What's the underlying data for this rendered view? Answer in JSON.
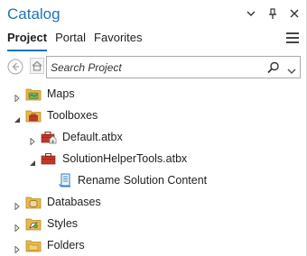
{
  "pane": {
    "title": "Catalog"
  },
  "tabs": [
    {
      "label": "Project",
      "active": true
    },
    {
      "label": "Portal",
      "active": false
    },
    {
      "label": "Favorites",
      "active": false
    }
  ],
  "search": {
    "placeholder": "Search Project",
    "value": ""
  },
  "tree": [
    {
      "label": "Maps",
      "icon": "maps-folder-icon",
      "expanded": false
    },
    {
      "label": "Toolboxes",
      "icon": "toolboxes-folder-icon",
      "expanded": true
    },
    {
      "label": "Default.atbx",
      "icon": "default-toolbox-icon",
      "expanded": false
    },
    {
      "label": "SolutionHelperTools.atbx",
      "icon": "toolbox-icon",
      "expanded": true
    },
    {
      "label": "Rename Solution Content",
      "icon": "script-tool-icon"
    },
    {
      "label": "Databases",
      "icon": "databases-folder-icon",
      "expanded": false
    },
    {
      "label": "Styles",
      "icon": "styles-folder-icon",
      "expanded": false
    },
    {
      "label": "Folders",
      "icon": "folders-folder-icon",
      "expanded": false
    }
  ],
  "colors": {
    "accent": "#1e73b8",
    "folder": "#e8b84a",
    "toolbox": "#c0392b"
  }
}
